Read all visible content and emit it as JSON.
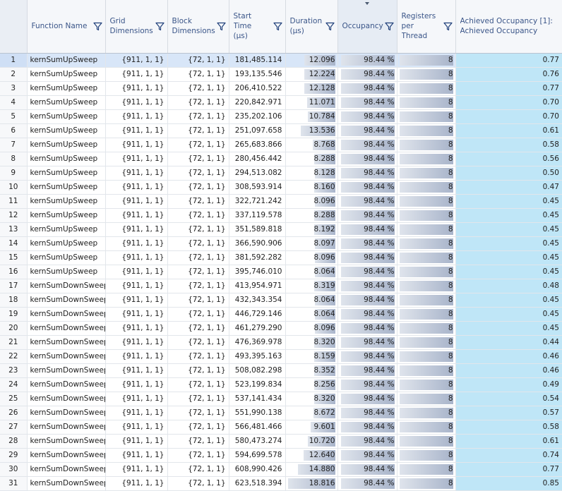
{
  "columns": {
    "function_name": "Function Name",
    "grid": "Grid\nDimensions",
    "block": "Block\nDimensions",
    "start_time": "Start Time\n(µs)",
    "duration": "Duration\n(µs)",
    "occupancy": "Occupancy",
    "registers": "Registers\nper Thread",
    "achieved": "Achieved Occupancy [1]:\nAchieved Occupancy"
  },
  "icons": {
    "filter": "filter-funnel-icon",
    "sort": "sort-descending-arrow-icon"
  },
  "colors": {
    "header_text": "#3a5588",
    "bar_light": "#dfe4ec",
    "bar_dark": "#a8b4ca",
    "achieved_bg": "#bfe6f7",
    "selected_row": "#d8e6f8"
  },
  "selected_row": 1,
  "duration_bar_max": 18.816,
  "rows": [
    {
      "n": "1",
      "fn": "kernSumUpSweep",
      "grid": "{911, 1, 1}",
      "block": "{72, 1, 1}",
      "start": "181,485.114",
      "dur": "12.096",
      "occ": "98.44 %",
      "occ_frac": 0.9844,
      "reg": "8",
      "ach": "0.77"
    },
    {
      "n": "2",
      "fn": "kernSumUpSweep",
      "grid": "{911, 1, 1}",
      "block": "{72, 1, 1}",
      "start": "193,135.546",
      "dur": "12.224",
      "occ": "98.44 %",
      "occ_frac": 0.9844,
      "reg": "8",
      "ach": "0.76"
    },
    {
      "n": "3",
      "fn": "kernSumUpSweep",
      "grid": "{911, 1, 1}",
      "block": "{72, 1, 1}",
      "start": "206,410.522",
      "dur": "12.128",
      "occ": "98.44 %",
      "occ_frac": 0.9844,
      "reg": "8",
      "ach": "0.77"
    },
    {
      "n": "4",
      "fn": "kernSumUpSweep",
      "grid": "{911, 1, 1}",
      "block": "{72, 1, 1}",
      "start": "220,842.971",
      "dur": "11.071",
      "occ": "98.44 %",
      "occ_frac": 0.9844,
      "reg": "8",
      "ach": "0.70"
    },
    {
      "n": "5",
      "fn": "kernSumUpSweep",
      "grid": "{911, 1, 1}",
      "block": "{72, 1, 1}",
      "start": "235,202.106",
      "dur": "10.784",
      "occ": "98.44 %",
      "occ_frac": 0.9844,
      "reg": "8",
      "ach": "0.70"
    },
    {
      "n": "6",
      "fn": "kernSumUpSweep",
      "grid": "{911, 1, 1}",
      "block": "{72, 1, 1}",
      "start": "251,097.658",
      "dur": "13.536",
      "occ": "98.44 %",
      "occ_frac": 0.9844,
      "reg": "8",
      "ach": "0.61"
    },
    {
      "n": "7",
      "fn": "kernSumUpSweep",
      "grid": "{911, 1, 1}",
      "block": "{72, 1, 1}",
      "start": "265,683.866",
      "dur": "8.768",
      "occ": "98.44 %",
      "occ_frac": 0.9844,
      "reg": "8",
      "ach": "0.58"
    },
    {
      "n": "8",
      "fn": "kernSumUpSweep",
      "grid": "{911, 1, 1}",
      "block": "{72, 1, 1}",
      "start": "280,456.442",
      "dur": "8.288",
      "occ": "98.44 %",
      "occ_frac": 0.9844,
      "reg": "8",
      "ach": "0.56"
    },
    {
      "n": "9",
      "fn": "kernSumUpSweep",
      "grid": "{911, 1, 1}",
      "block": "{72, 1, 1}",
      "start": "294,513.082",
      "dur": "8.128",
      "occ": "98.44 %",
      "occ_frac": 0.9844,
      "reg": "8",
      "ach": "0.50"
    },
    {
      "n": "10",
      "fn": "kernSumUpSweep",
      "grid": "{911, 1, 1}",
      "block": "{72, 1, 1}",
      "start": "308,593.914",
      "dur": "8.160",
      "occ": "98.44 %",
      "occ_frac": 0.9844,
      "reg": "8",
      "ach": "0.47"
    },
    {
      "n": "11",
      "fn": "kernSumUpSweep",
      "grid": "{911, 1, 1}",
      "block": "{72, 1, 1}",
      "start": "322,721.242",
      "dur": "8.096",
      "occ": "98.44 %",
      "occ_frac": 0.9844,
      "reg": "8",
      "ach": "0.45"
    },
    {
      "n": "12",
      "fn": "kernSumUpSweep",
      "grid": "{911, 1, 1}",
      "block": "{72, 1, 1}",
      "start": "337,119.578",
      "dur": "8.288",
      "occ": "98.44 %",
      "occ_frac": 0.9844,
      "reg": "8",
      "ach": "0.45"
    },
    {
      "n": "13",
      "fn": "kernSumUpSweep",
      "grid": "{911, 1, 1}",
      "block": "{72, 1, 1}",
      "start": "351,589.818",
      "dur": "8.192",
      "occ": "98.44 %",
      "occ_frac": 0.9844,
      "reg": "8",
      "ach": "0.45"
    },
    {
      "n": "14",
      "fn": "kernSumUpSweep",
      "grid": "{911, 1, 1}",
      "block": "{72, 1, 1}",
      "start": "366,590.906",
      "dur": "8.097",
      "occ": "98.44 %",
      "occ_frac": 0.9844,
      "reg": "8",
      "ach": "0.45"
    },
    {
      "n": "15",
      "fn": "kernSumUpSweep",
      "grid": "{911, 1, 1}",
      "block": "{72, 1, 1}",
      "start": "381,592.282",
      "dur": "8.096",
      "occ": "98.44 %",
      "occ_frac": 0.9844,
      "reg": "8",
      "ach": "0.45"
    },
    {
      "n": "16",
      "fn": "kernSumUpSweep",
      "grid": "{911, 1, 1}",
      "block": "{72, 1, 1}",
      "start": "395,746.010",
      "dur": "8.064",
      "occ": "98.44 %",
      "occ_frac": 0.9844,
      "reg": "8",
      "ach": "0.45"
    },
    {
      "n": "17",
      "fn": "kernSumDownSweep",
      "grid": "{911, 1, 1}",
      "block": "{72, 1, 1}",
      "start": "413,954.971",
      "dur": "8.319",
      "occ": "98.44 %",
      "occ_frac": 0.9844,
      "reg": "8",
      "ach": "0.48"
    },
    {
      "n": "18",
      "fn": "kernSumDownSweep",
      "grid": "{911, 1, 1}",
      "block": "{72, 1, 1}",
      "start": "432,343.354",
      "dur": "8.064",
      "occ": "98.44 %",
      "occ_frac": 0.9844,
      "reg": "8",
      "ach": "0.45"
    },
    {
      "n": "19",
      "fn": "kernSumDownSweep",
      "grid": "{911, 1, 1}",
      "block": "{72, 1, 1}",
      "start": "446,729.146",
      "dur": "8.064",
      "occ": "98.44 %",
      "occ_frac": 0.9844,
      "reg": "8",
      "ach": "0.45"
    },
    {
      "n": "20",
      "fn": "kernSumDownSweep",
      "grid": "{911, 1, 1}",
      "block": "{72, 1, 1}",
      "start": "461,279.290",
      "dur": "8.096",
      "occ": "98.44 %",
      "occ_frac": 0.9844,
      "reg": "8",
      "ach": "0.45"
    },
    {
      "n": "21",
      "fn": "kernSumDownSweep",
      "grid": "{911, 1, 1}",
      "block": "{72, 1, 1}",
      "start": "476,369.978",
      "dur": "8.320",
      "occ": "98.44 %",
      "occ_frac": 0.9844,
      "reg": "8",
      "ach": "0.44"
    },
    {
      "n": "22",
      "fn": "kernSumDownSweep",
      "grid": "{911, 1, 1}",
      "block": "{72, 1, 1}",
      "start": "493,395.163",
      "dur": "8.159",
      "occ": "98.44 %",
      "occ_frac": 0.9844,
      "reg": "8",
      "ach": "0.46"
    },
    {
      "n": "23",
      "fn": "kernSumDownSweep",
      "grid": "{911, 1, 1}",
      "block": "{72, 1, 1}",
      "start": "508,082.298",
      "dur": "8.352",
      "occ": "98.44 %",
      "occ_frac": 0.9844,
      "reg": "8",
      "ach": "0.46"
    },
    {
      "n": "24",
      "fn": "kernSumDownSweep",
      "grid": "{911, 1, 1}",
      "block": "{72, 1, 1}",
      "start": "523,199.834",
      "dur": "8.256",
      "occ": "98.44 %",
      "occ_frac": 0.9844,
      "reg": "8",
      "ach": "0.49"
    },
    {
      "n": "25",
      "fn": "kernSumDownSweep",
      "grid": "{911, 1, 1}",
      "block": "{72, 1, 1}",
      "start": "537,141.434",
      "dur": "8.320",
      "occ": "98.44 %",
      "occ_frac": 0.9844,
      "reg": "8",
      "ach": "0.54"
    },
    {
      "n": "26",
      "fn": "kernSumDownSweep",
      "grid": "{911, 1, 1}",
      "block": "{72, 1, 1}",
      "start": "551,990.138",
      "dur": "8.672",
      "occ": "98.44 %",
      "occ_frac": 0.9844,
      "reg": "8",
      "ach": "0.57"
    },
    {
      "n": "27",
      "fn": "kernSumDownSweep",
      "grid": "{911, 1, 1}",
      "block": "{72, 1, 1}",
      "start": "566,481.466",
      "dur": "9.601",
      "occ": "98.44 %",
      "occ_frac": 0.9844,
      "reg": "8",
      "ach": "0.58"
    },
    {
      "n": "28",
      "fn": "kernSumDownSweep",
      "grid": "{911, 1, 1}",
      "block": "{72, 1, 1}",
      "start": "580,473.274",
      "dur": "10.720",
      "occ": "98.44 %",
      "occ_frac": 0.9844,
      "reg": "8",
      "ach": "0.61"
    },
    {
      "n": "29",
      "fn": "kernSumDownSweep",
      "grid": "{911, 1, 1}",
      "block": "{72, 1, 1}",
      "start": "594,699.578",
      "dur": "12.640",
      "occ": "98.44 %",
      "occ_frac": 0.9844,
      "reg": "8",
      "ach": "0.74"
    },
    {
      "n": "30",
      "fn": "kernSumDownSweep",
      "grid": "{911, 1, 1}",
      "block": "{72, 1, 1}",
      "start": "608,990.426",
      "dur": "14.880",
      "occ": "98.44 %",
      "occ_frac": 0.9844,
      "reg": "8",
      "ach": "0.77"
    },
    {
      "n": "31",
      "fn": "kernSumDownSweep",
      "grid": "{911, 1, 1}",
      "block": "{72, 1, 1}",
      "start": "623,518.394",
      "dur": "18.816",
      "occ": "98.44 %",
      "occ_frac": 0.9844,
      "reg": "8",
      "ach": "0.85"
    }
  ]
}
